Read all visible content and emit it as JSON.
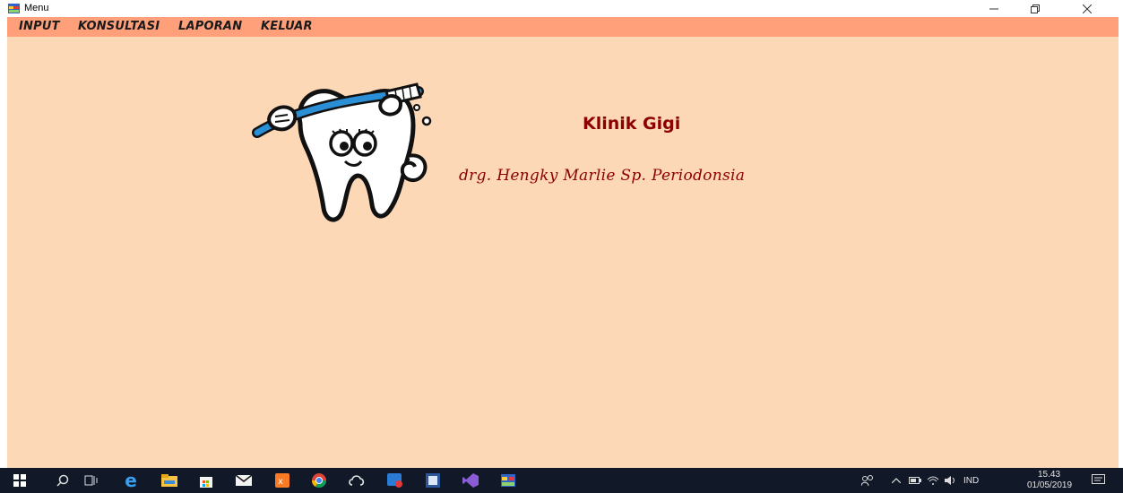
{
  "window": {
    "title": "Menu"
  },
  "menu": {
    "items": [
      "INPUT",
      "KONSULTASI",
      "LAPORAN",
      "KELUAR"
    ]
  },
  "main": {
    "clinic_title": "Klinik Gigi",
    "doctor_name": "drg. Hengky Marlie Sp. Periodonsia"
  },
  "taskbar": {
    "apps": [
      "windows-start-icon",
      "search-icon",
      "task-view-icon",
      "edge-icon",
      "file-explorer-icon",
      "store-icon",
      "mail-icon",
      "xampp-icon",
      "chrome-icon",
      "creative-cloud-icon",
      "app-badge-icon",
      "word-icon",
      "visual-studio-icon",
      "vb-app-icon"
    ],
    "tray": {
      "language": "IND",
      "time": "15.43",
      "date": "01/05/2019"
    }
  },
  "colors": {
    "menubar": "#ffa07a",
    "background": "#fdd8b7",
    "text_accent": "#8b0000",
    "taskbar": "#111827"
  }
}
